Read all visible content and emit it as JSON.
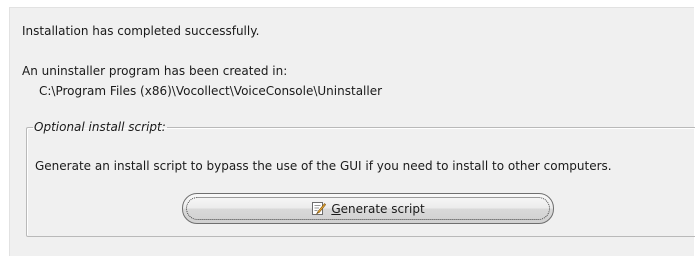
{
  "status": {
    "message": "Installation has completed successfully."
  },
  "uninstaller": {
    "label": "An uninstaller program has been created in:",
    "path": "C:\\Program Files (x86)\\Vocollect\\VoiceConsole\\Uninstaller"
  },
  "optional_script": {
    "legend": "Optional install script:",
    "description": "Generate an install script to bypass the use of the GUI if you need to install to other computers.",
    "button": {
      "mnemonic": "G",
      "label_rest": "enerate script",
      "icon": "edit-document-icon"
    }
  }
}
